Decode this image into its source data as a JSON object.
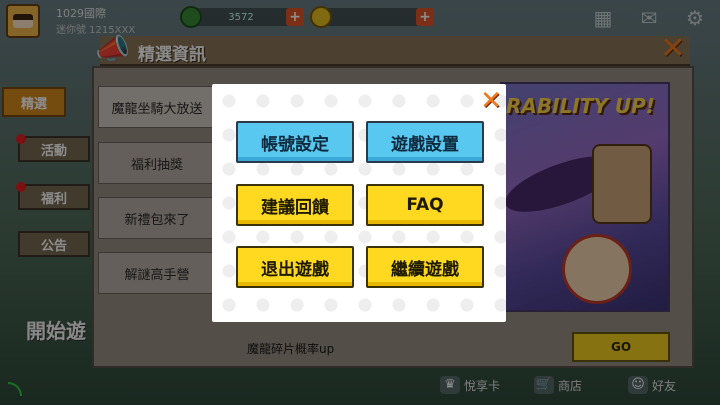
{
  "hud": {
    "player_name": "1029國際",
    "player_id": "迷你號 1215XXX",
    "resource1": "3572",
    "resource2": "",
    "plus_label": "+"
  },
  "sidebar": {
    "tabs": [
      {
        "label": "精選"
      },
      {
        "label": "活動"
      },
      {
        "label": "福利"
      },
      {
        "label": "公告"
      }
    ],
    "start_label": "開始遊"
  },
  "news": {
    "title": "精選資訊",
    "items": [
      {
        "label": "魔龍坐騎大放送"
      },
      {
        "label": "福利抽獎"
      },
      {
        "label": "新禮包來了"
      },
      {
        "label": "解謎高手營"
      }
    ],
    "image_text": "RABILITY UP!",
    "footer_label": "魔龍碎片概率up",
    "go_label": "GO"
  },
  "bottom_bar": {
    "items": [
      {
        "label": "悅享卡"
      },
      {
        "label": "商店"
      },
      {
        "label": "好友"
      }
    ]
  },
  "modal": {
    "buttons": [
      {
        "label": "帳號設定",
        "style": "blue"
      },
      {
        "label": "遊戲設置",
        "style": "blue"
      },
      {
        "label": "建議回饋",
        "style": "yellow"
      },
      {
        "label": "FAQ",
        "style": "yellow"
      },
      {
        "label": "退出遊戲",
        "style": "yellow"
      },
      {
        "label": "繼續遊戲",
        "style": "yellow"
      }
    ]
  },
  "colors": {
    "accent_orange": "#f07a20",
    "button_blue": "#58c8f0",
    "button_yellow": "#ffd820"
  }
}
